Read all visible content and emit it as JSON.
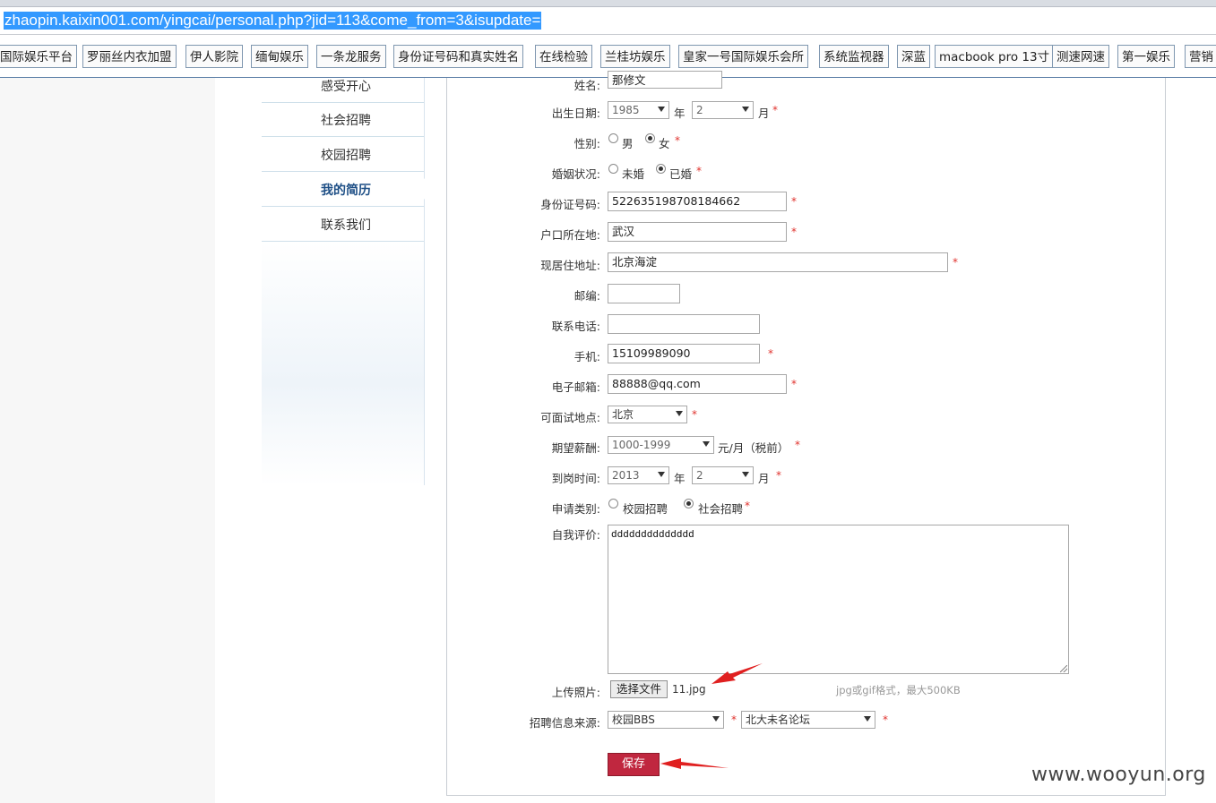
{
  "browser": {
    "url": "zhaopin.kaixin001.com/yingcai/personal.php?jid=113&come_from=3&isupdate="
  },
  "bookmarks": [
    "国际娱乐平台",
    "罗丽丝内衣加盟",
    "伊人影院",
    "缅甸娱乐",
    "一条龙服务",
    "身份证号码和真实姓名",
    "在线检验",
    "兰桂坊娱乐",
    "皇家一号国际娱乐会所",
    "系统监视器",
    "深蓝",
    "macbook pro 13寸",
    "测速网速",
    "第一娱乐",
    "营销"
  ],
  "sidebar": {
    "items": [
      {
        "label": "感受开心"
      },
      {
        "label": "社会招聘"
      },
      {
        "label": "校园招聘"
      },
      {
        "label": "我的简历"
      },
      {
        "label": "联系我们"
      }
    ]
  },
  "form": {
    "name_label": "姓名:",
    "name_value": "那修文",
    "birth_label": "出生日期:",
    "birth_year": "1985",
    "year_unit": "年",
    "birth_month": "2",
    "month_unit": "月",
    "gender_label": "性别:",
    "gender_male": "男",
    "gender_female": "女",
    "marital_label": "婚姻状况:",
    "marital_single": "未婚",
    "marital_married": "已婚",
    "id_label": "身份证号码:",
    "id_value": "522635198708184662",
    "hukou_label": "户口所在地:",
    "hukou_value": "武汉",
    "address_label": "现居住地址:",
    "address_value": "北京海淀",
    "zip_label": "邮编:",
    "zip_value": "",
    "phone_label": "联系电话:",
    "phone_value": "",
    "mobile_label": "手机:",
    "mobile_value": "15109989090",
    "email_label": "电子邮箱:",
    "email_value": "88888@qq.com",
    "interview_label": "可面试地点:",
    "interview_value": "北京",
    "salary_label": "期望薪酬:",
    "salary_value": "1000-1999",
    "salary_unit": "元/月（税前）",
    "arrival_label": "到岗时间:",
    "arrival_year": "2013",
    "arrival_month": "2",
    "category_label": "申请类别:",
    "category_campus": "校园招聘",
    "category_social": "社会招聘",
    "self_eval_label": "自我评价:",
    "self_eval_value": "dddddddddddddd",
    "photo_label": "上传照片:",
    "file_button": "选择文件",
    "file_name": "11.jpg",
    "file_hint": "jpg或gif格式，最大500KB",
    "source_label": "招聘信息来源:",
    "source_value": "校园BBS",
    "source_detail": "北大未名论坛",
    "save_button": "保存",
    "required_mark": "*"
  },
  "watermark": "www.wooyun.org",
  "colors": {
    "save_button": "#c0273f",
    "annotation_arrow": "#e02020",
    "url_highlight": "#3399ff"
  }
}
